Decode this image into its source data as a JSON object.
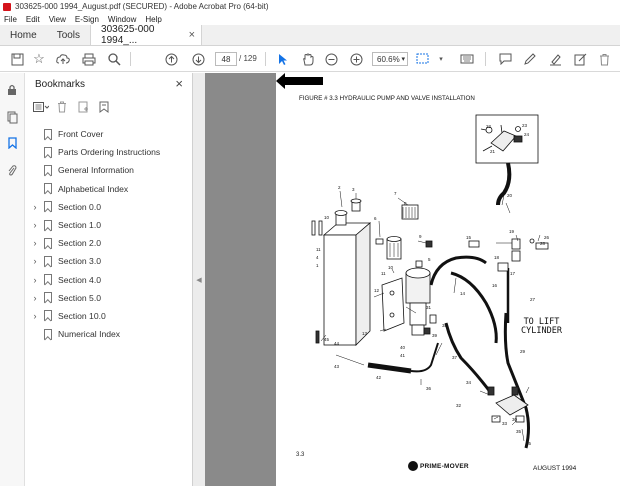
{
  "window": {
    "title": "303625-000 1994_August.pdf (SECURED) - Adobe Acrobat Pro (64-bit)"
  },
  "menu": [
    "File",
    "Edit",
    "View",
    "E-Sign",
    "Window",
    "Help"
  ],
  "tabs": {
    "home": "Home",
    "tools": "Tools",
    "document": "303625-000 1994_...",
    "document_close": "×"
  },
  "toolbar": {
    "page_current": "48",
    "page_total": "/ 129",
    "zoom": "60.6%",
    "icons": [
      "save-icon",
      "bookmark-star-icon",
      "upload-icon",
      "print-icon",
      "zoom-search-icon",
      "prev-page-icon",
      "next-page-icon",
      "select-cursor-icon",
      "hand-icon",
      "zoom-out-icon",
      "zoom-in-icon",
      "zoom-dropdown-icon",
      "marquee-icon",
      "keyboard-icon",
      "comment-icon",
      "pen-icon",
      "highlight-icon",
      "redact-icon",
      "delete-icon"
    ]
  },
  "bookmarks": {
    "title": "Bookmarks",
    "close": "×",
    "items": [
      {
        "label": "Front Cover",
        "expandable": false
      },
      {
        "label": "Parts Ordering Instructions",
        "expandable": false
      },
      {
        "label": "General Information",
        "expandable": false
      },
      {
        "label": "Alphabetical Index",
        "expandable": false
      },
      {
        "label": "Section 0.0",
        "expandable": true
      },
      {
        "label": "Section 1.0",
        "expandable": true
      },
      {
        "label": "Section 2.0",
        "expandable": true
      },
      {
        "label": "Section 3.0",
        "expandable": true
      },
      {
        "label": "Section 4.0",
        "expandable": true
      },
      {
        "label": "Section 5.0",
        "expandable": true
      },
      {
        "label": "Section 10.0",
        "expandable": true
      },
      {
        "label": "Numerical Index",
        "expandable": false
      }
    ]
  },
  "document": {
    "figure_title": "FIGURE # 3.3 HYDRAULIC PUMP AND VALVE INSTALLATION",
    "callout": [
      "TO LIFT",
      "CYLINDER"
    ],
    "page_number": "3.3",
    "return_label": "Return",
    "brand": "PRIME-MOVER",
    "date": "AUGUST 1994",
    "part_numbers": [
      "1",
      "2",
      "3",
      "4",
      "5",
      "6",
      "7",
      "8",
      "9",
      "10",
      "11",
      "12",
      "13",
      "14",
      "15",
      "16",
      "17",
      "18",
      "19",
      "20",
      "21",
      "22",
      "23",
      "24",
      "25",
      "26",
      "27",
      "28",
      "29",
      "30",
      "31",
      "32",
      "33",
      "34",
      "35",
      "36",
      "37",
      "38",
      "39",
      "40",
      "41",
      "42",
      "43",
      "44",
      "45"
    ]
  }
}
